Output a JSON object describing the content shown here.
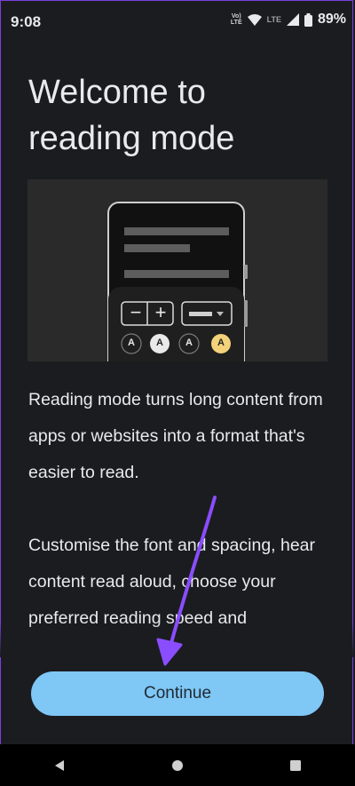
{
  "status_bar": {
    "time": "9:08",
    "volte_top": "VoLTE",
    "volte_line1": "Vo)",
    "volte_line2": "LTE",
    "lte_label": "LTE",
    "battery": "89%",
    "battery_level": 0.89
  },
  "page": {
    "title_line1": "Welcome to",
    "title_line2": "reading mode",
    "paragraph1": "Reading mode turns long content from apps or websites into a format that's easier to read.",
    "paragraph2": "Customise the font and spacing, hear content read aloud, choose your preferred reading speed and"
  },
  "illustration": {
    "font_buttons": [
      "A",
      "A",
      "A",
      "A"
    ],
    "minus_symbol": "−",
    "plus_symbol": "+"
  },
  "actions": {
    "continue_label": "Continue"
  },
  "colors": {
    "background": "#1b1c20",
    "accent_button": "#7fc7f5",
    "annotation_arrow": "#8a4dff",
    "highlight_font": "#f3d27a"
  }
}
